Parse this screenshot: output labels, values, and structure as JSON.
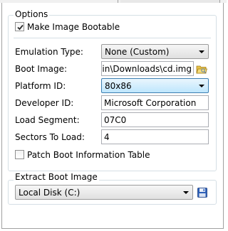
{
  "options_group": {
    "title": "Options",
    "make_bootable_label": "Make Image Bootable",
    "make_bootable_checked": true
  },
  "fields": {
    "emulation_type": {
      "label": "Emulation Type:",
      "value": "None (Custom)"
    },
    "boot_image": {
      "label": "Boot Image:",
      "value": "rain\\Downloads\\cd.img"
    },
    "platform_id": {
      "label": "Platform ID:",
      "value": "80x86"
    },
    "developer_id": {
      "label": "Developer ID:",
      "value": "Microsoft Corporation"
    },
    "load_segment": {
      "label": "Load Segment:",
      "value": "07C0"
    },
    "sectors_to_load": {
      "label": "Sectors To Load:",
      "value": "4"
    }
  },
  "patch_boot_info": {
    "label": "Patch Boot Information Table",
    "checked": false
  },
  "extract_group": {
    "title": "Extract Boot Image",
    "drive_value": "Local Disk (C:)"
  },
  "icons": {
    "browse": "folder-open-icon",
    "save": "floppy-disk-save-icon"
  },
  "colors": {
    "group_border": "#d5dfe5",
    "combo_active_border": "#3c7fb1",
    "save_icon_blue": "#2c5fb8",
    "folder_yellow": "#e8c24a"
  }
}
